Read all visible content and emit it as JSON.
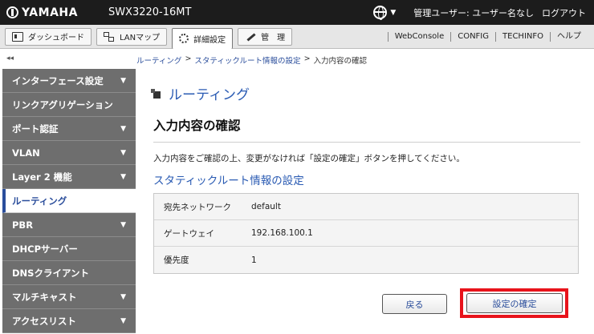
{
  "header": {
    "logo_text": "YAMAHA",
    "model": "SWX3220-16MT",
    "language_caret": "▼",
    "user_info": "管理ユーザー: ユーザー名なし",
    "logout": "ログアウト"
  },
  "nav": {
    "tabs": [
      {
        "label": "ダッシュボード",
        "icon": "dashboard-icon"
      },
      {
        "label": "LANマップ",
        "icon": "lan-map-icon"
      },
      {
        "label": "詳細設定",
        "icon": "gear-icon"
      },
      {
        "label": "管　理",
        "icon": "wrench-icon"
      }
    ],
    "links": [
      "WebConsole",
      "CONFIG",
      "TECHINFO",
      "ヘルプ"
    ]
  },
  "collapse_label": "◂◂",
  "breadcrumb": {
    "items": [
      "ルーティング",
      "スタティックルート情報の設定"
    ],
    "current": "入力内容の確認",
    "separator": ">"
  },
  "sidebar": {
    "items": [
      {
        "label": "インターフェース設定",
        "arrow": "▼"
      },
      {
        "label": "リンクアグリゲーション",
        "arrow": ""
      },
      {
        "label": "ポート認証",
        "arrow": "▼"
      },
      {
        "label": "VLAN",
        "arrow": "▼"
      },
      {
        "label": "Layer 2 機能",
        "arrow": "▼"
      },
      {
        "label": "ルーティング",
        "arrow": ""
      },
      {
        "label": "PBR",
        "arrow": "▼"
      },
      {
        "label": "DHCPサーバー",
        "arrow": ""
      },
      {
        "label": "DNSクライアント",
        "arrow": ""
      },
      {
        "label": "マルチキャスト",
        "arrow": "▼"
      },
      {
        "label": "アクセスリスト",
        "arrow": "▼"
      }
    ],
    "active_index": 5
  },
  "main": {
    "page_title": "ルーティング",
    "section_title": "入力内容の確認",
    "description": "入力内容をご確認の上、変更がなければ「設定の確定」ボタンを押してください。",
    "subtitle": "スタティックルート情報の設定",
    "rows": [
      {
        "key": "宛先ネットワーク",
        "value": "default"
      },
      {
        "key": "ゲートウェイ",
        "value": "192.168.100.1"
      },
      {
        "key": "優先度",
        "value": "1"
      }
    ]
  },
  "buttons": {
    "back": "戻る",
    "confirm": "設定の確定"
  },
  "colors": {
    "highlight": "#e8131b",
    "accent": "#2a5bb3"
  }
}
